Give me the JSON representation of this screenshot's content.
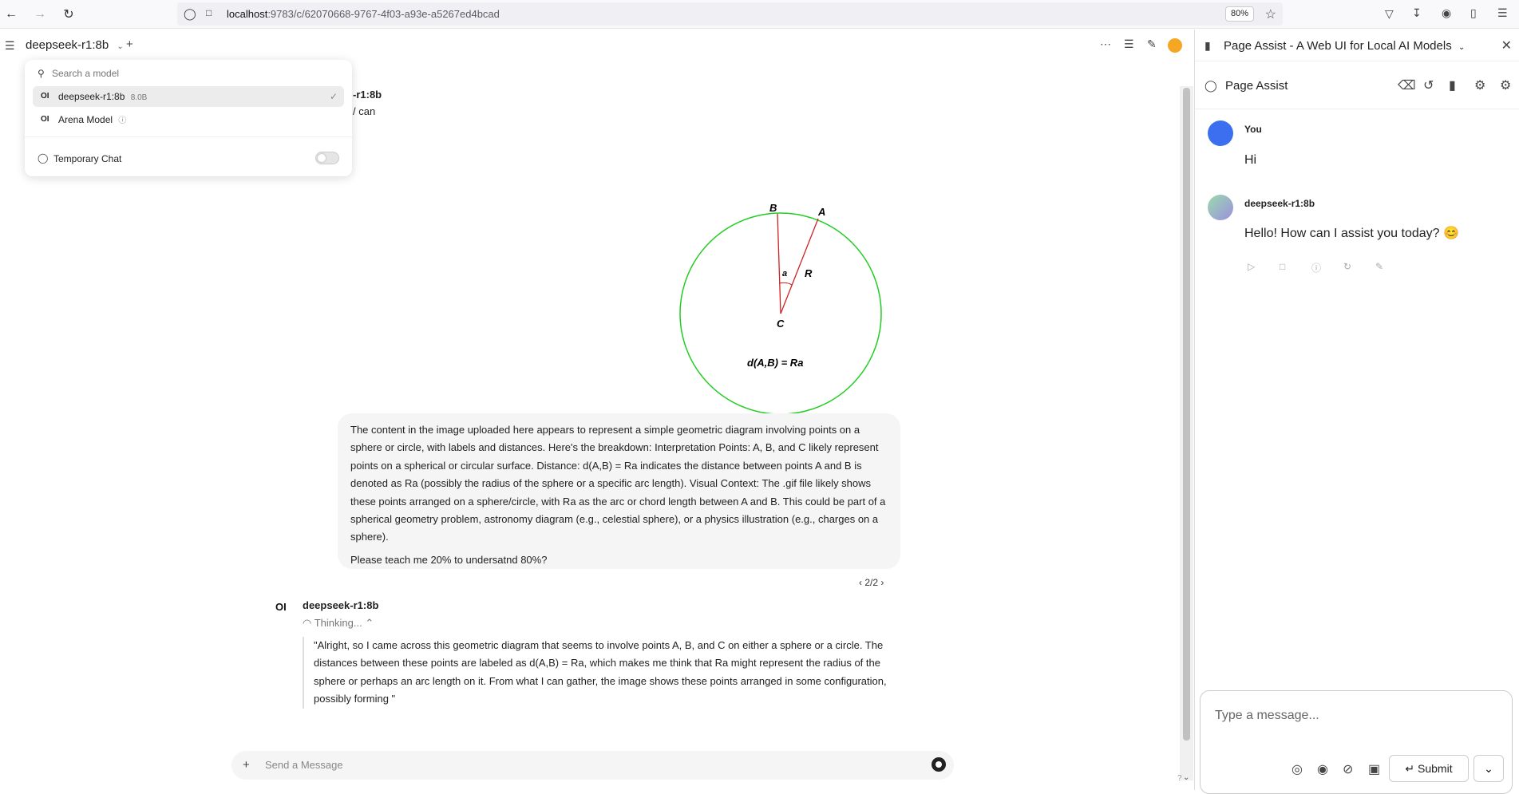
{
  "browser": {
    "url_host": "localhost",
    "url_path": ":9783/c/62070668-9767-4f03-a93e-a5267ed4bcad",
    "zoom": "80%"
  },
  "app": {
    "model_title": "deepseek-r1:8b"
  },
  "model_dropdown": {
    "search_placeholder": "Search a model",
    "items": [
      {
        "label": "deepseek-r1:8b",
        "size": "8.0B"
      },
      {
        "label": "Arena Model"
      }
    ],
    "temporary_chat": "Temporary Chat"
  },
  "partial_header": {
    "model_tail": "-r1:8b",
    "text_tail": "/ can"
  },
  "figure": {
    "label_b": "B",
    "label_a": "A",
    "label_r": "R",
    "label_theta": "a",
    "label_c": "C",
    "equation": "d(A,B) = Ra"
  },
  "user_message": {
    "paragraph": "The content in the image uploaded here appears to represent a simple geometric diagram involving points on a sphere or circle, with labels and distances. Here's the breakdown: Interpretation Points: A, B, and C likely represent points on a spherical or circular surface. Distance: d(A,B) = Ra indicates the distance between points A and B is denoted as Ra (possibly the radius of the sphere or a specific arc length). Visual Context: The .gif file likely shows these points arranged on a sphere/circle, with Ra as the arc or chord length between A and B. This could be part of a spherical geometry problem, astronomy diagram (e.g., celestial sphere), or a physics illustration (e.g., charges on a sphere).",
    "question": "Please teach me 20% to undersatnd 80%?"
  },
  "pager": {
    "label": "2/2"
  },
  "assistant": {
    "logo": "OI",
    "name": "deepseek-r1:8b",
    "thinking_label": "Thinking...",
    "thinking_text": "\"Alright, so I came across this geometric diagram that seems to involve points A, B, and C on either a sphere or a circle. The distances between these points are labeled as d(A,B) = Ra, which makes me think that Ra might represent the radius of the sphere or perhaps an arc length on it. From what I can gather, the image shows these points arranged in some configuration, possibly forming \""
  },
  "chat_input": {
    "placeholder": "Send a Message"
  },
  "side_panel": {
    "title": "Page Assist - A Web UI for Local AI Models",
    "app_name": "Page Assist",
    "messages": [
      {
        "name": "You",
        "text": "Hi"
      },
      {
        "name": "deepseek-r1:8b",
        "text": "Hello! How can I assist you today? 😊"
      }
    ],
    "input_placeholder": "Type a message...",
    "submit_label": "Submit"
  },
  "colors": {
    "circle": "#22cc22",
    "radius_lines": "#cc2222",
    "avatar_user": "#3b6ff0",
    "avatar_bot": "#9b8fe0",
    "user_badge": "#f5a623"
  }
}
